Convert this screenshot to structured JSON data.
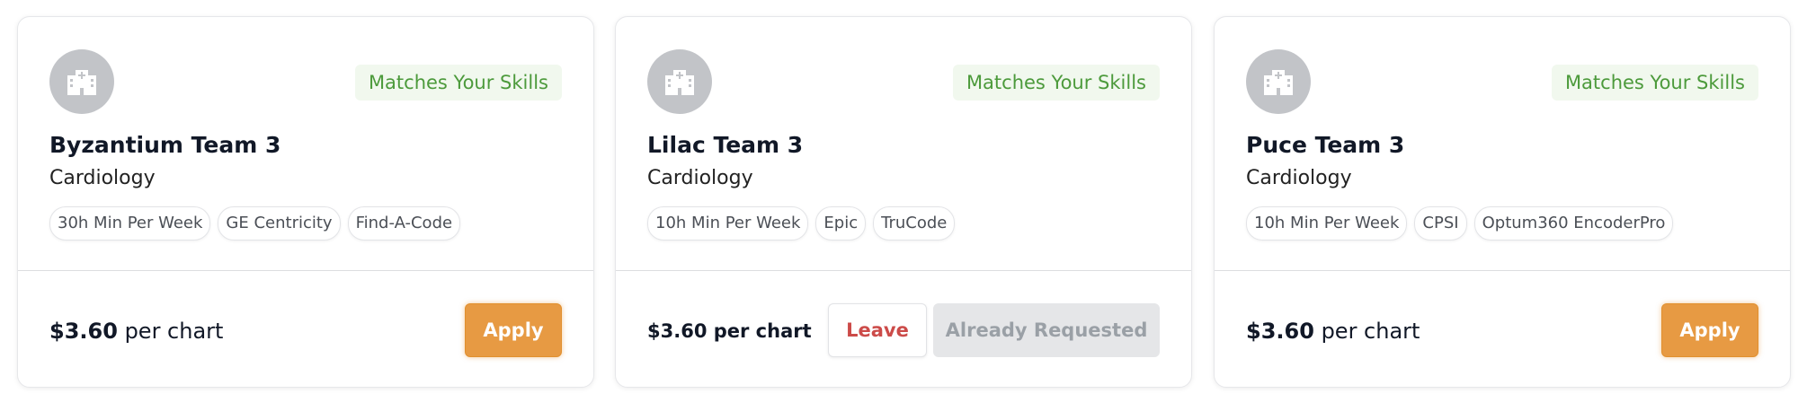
{
  "cards": [
    {
      "badge": "Matches Your Skills",
      "title": "Byzantium Team 3",
      "specialty": "Cardiology",
      "tags": [
        "30h Min Per Week",
        "GE Centricity",
        "Find-A-Code"
      ],
      "price_amount": "$3.60",
      "price_unit": "per chart",
      "apply_label": "Apply"
    },
    {
      "badge": "Matches Your Skills",
      "title": "Lilac Team 3",
      "specialty": "Cardiology",
      "tags": [
        "10h Min Per Week",
        "Epic",
        "TruCode"
      ],
      "price_text": "$3.60 per chart",
      "leave_label": "Leave",
      "requested_label": "Already Requested"
    },
    {
      "badge": "Matches Your Skills",
      "title": "Puce Team 3",
      "specialty": "Cardiology",
      "tags": [
        "10h Min Per Week",
        "CPSI",
        "Optum360 EncoderPro"
      ],
      "price_amount": "$3.60",
      "price_unit": "per chart",
      "apply_label": "Apply"
    }
  ],
  "icons": {
    "avatar": "hospital-building-icon"
  },
  "colors": {
    "accent": "#e79a43",
    "match_text": "#4c9a3b",
    "match_bg": "#f1f8ee",
    "leave_text": "#cc4b49",
    "disabled_bg": "#e5e6e8",
    "avatar_bg": "#c2c4c8"
  }
}
